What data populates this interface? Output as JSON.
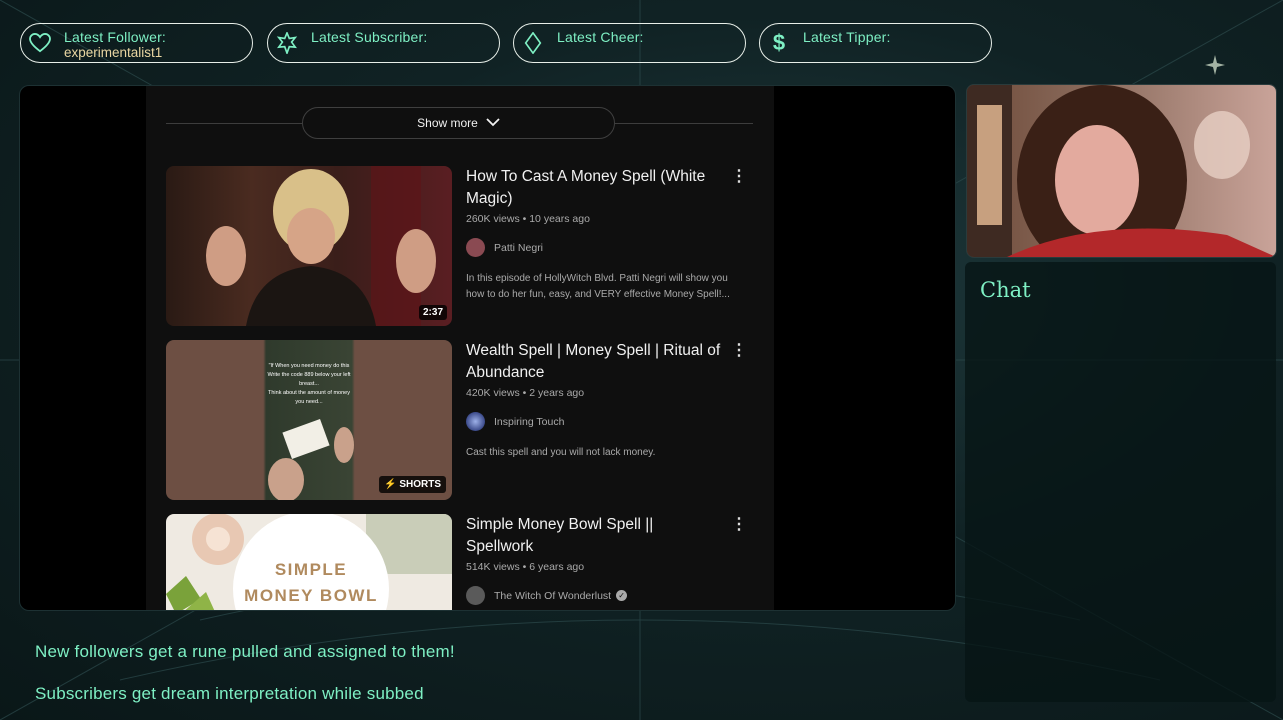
{
  "alerts": [
    {
      "label": "Latest Follower:",
      "value": "experimentalist1",
      "icon": "heart-icon"
    },
    {
      "label": "Latest Subscriber:",
      "value": "",
      "icon": "star-icon"
    },
    {
      "label": "Latest Cheer:",
      "value": "",
      "icon": "diamond-icon"
    },
    {
      "label": "Latest Tipper:",
      "value": "",
      "icon": "dollar-icon"
    }
  ],
  "youtube": {
    "show_more": "Show more",
    "videos": [
      {
        "title": "How To Cast A Money Spell (White Magic)",
        "views": "260K views",
        "age": "10 years ago",
        "channel": "Patti Negri",
        "description": "In this episode of HollyWitch Blvd. Patti Negri will show you how to do her fun, easy, and VERY effective Money Spell!...",
        "duration": "2:37"
      },
      {
        "title": "Wealth Spell | Money Spell | Ritual of Abundance",
        "views": "420K views",
        "age": "2 years ago",
        "channel": "Inspiring Touch",
        "description": "Cast this spell and you will not lack money.",
        "badge": "SHORTS",
        "thumb_text": [
          "\"If When you need money do this",
          "Write the code 889 below your left breast...",
          "Think about the amount of money you need..."
        ]
      },
      {
        "title": "Simple Money Bowl Spell || Spellwork",
        "views": "514K views",
        "age": "6 years ago",
        "channel": "The Witch Of Wonderlust",
        "thumb_text": [
          "SIMPLE",
          "MONEY BOWL"
        ]
      }
    ]
  },
  "chat": {
    "title": "Chat"
  },
  "notes": [
    "New followers get a rune pulled and assigned to them!",
    "Subscribers get dream interpretation while subbed"
  ],
  "colors": {
    "accent": "#7ef0c4",
    "follower_name": "#e9d6a2",
    "background": "#102224"
  }
}
